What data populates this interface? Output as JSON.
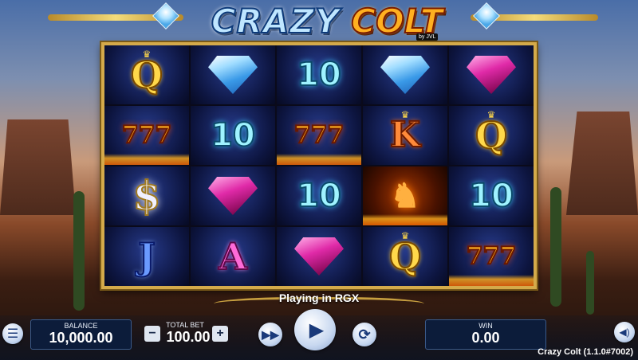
{
  "game": {
    "title_word1": "CRAZY",
    "title_word2": "COLT",
    "byline": "by JVL",
    "status": "Playing in RGX",
    "version": "Crazy Colt (1.1.0#7002)"
  },
  "reels": [
    [
      "Q",
      "blue-diamond",
      "10",
      "blue-diamond",
      "pink-diamond"
    ],
    [
      "7",
      "10",
      "7",
      "K",
      "Q"
    ],
    [
      "$",
      "pink-diamond",
      "10",
      "horse",
      "10"
    ],
    [
      "J",
      "A",
      "pink-diamond",
      "Q",
      "7"
    ]
  ],
  "bottom_bar": {
    "balance_label": "BALANCE",
    "balance_value": "10,000.00",
    "total_bet_label": "TOTAL BET",
    "total_bet_value": "100.00",
    "win_label": "WIN",
    "win_value": "0.00"
  },
  "icons": {
    "menu": "menu-icon",
    "minus": "−",
    "plus": "+",
    "fast_forward": "⏩",
    "play": "▶",
    "autoplay": "⟳",
    "sound": "🔊"
  },
  "colors": {
    "frame_gold": "#d4aa4a",
    "panel_bg": "#0c1c3a",
    "ten_cyan": "#9ff3ff"
  }
}
